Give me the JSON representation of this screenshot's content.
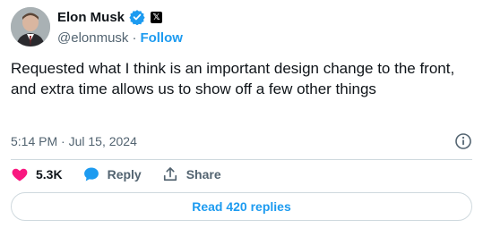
{
  "author": {
    "name": "Elon Musk",
    "handle": "@elonmusk",
    "follow_label": "Follow",
    "separator": "·"
  },
  "tweet": {
    "text": "Requested what I think is an important design change to the front, and extra time allows us to show off a few other things",
    "timestamp": "5:14 PM · Jul 15, 2024"
  },
  "actions": {
    "like_count": "5.3K",
    "reply_label": "Reply",
    "share_label": "Share"
  },
  "replies_button": "Read 420 replies",
  "colors": {
    "accent": "#1d9bf0",
    "like": "#f91880",
    "muted": "#536471"
  },
  "icons": {
    "verified": "verified-badge-icon",
    "platform": "x-logo-icon",
    "info": "info-icon",
    "like": "heart-icon",
    "reply": "speech-bubble-icon",
    "share": "share-icon"
  }
}
